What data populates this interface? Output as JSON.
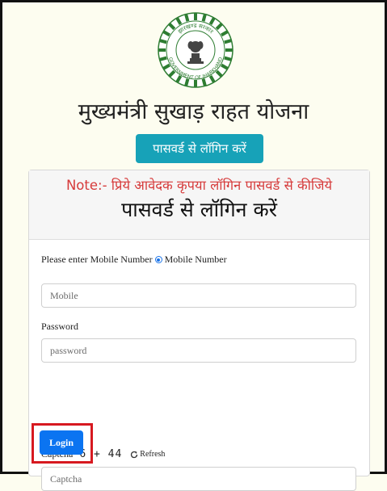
{
  "emblem": {
    "top_text": "झारखण्ड सरकार",
    "bottom_text": "GOVERNMENT OF JHARKHAND"
  },
  "header": {
    "title": "मुख्यमंत्री सुखाड़ राहत योजना",
    "button_label": "पासवर्ड से लॉगिन करें"
  },
  "card": {
    "note": "Note:- प्रिये आवेदक कृपया लॉगिन पासवर्ड से कीजिये",
    "title": "पासवर्ड से लॉगिन करें"
  },
  "form": {
    "mobile_prompt": "Please enter Mobile Number",
    "radio_label": "Mobile Number",
    "mobile_placeholder": "Mobile",
    "password_label": "Password",
    "password_placeholder": "password",
    "captcha_label": "Captcha",
    "captcha_code": "6 + 44",
    "refresh_label": "Refresh",
    "captcha_placeholder": "Captcha",
    "login_label": "Login"
  },
  "colors": {
    "primary_button": "#0b74f1",
    "info_button": "#17a2b8",
    "note_text": "#d63a3a",
    "highlight_border": "#d71920"
  }
}
